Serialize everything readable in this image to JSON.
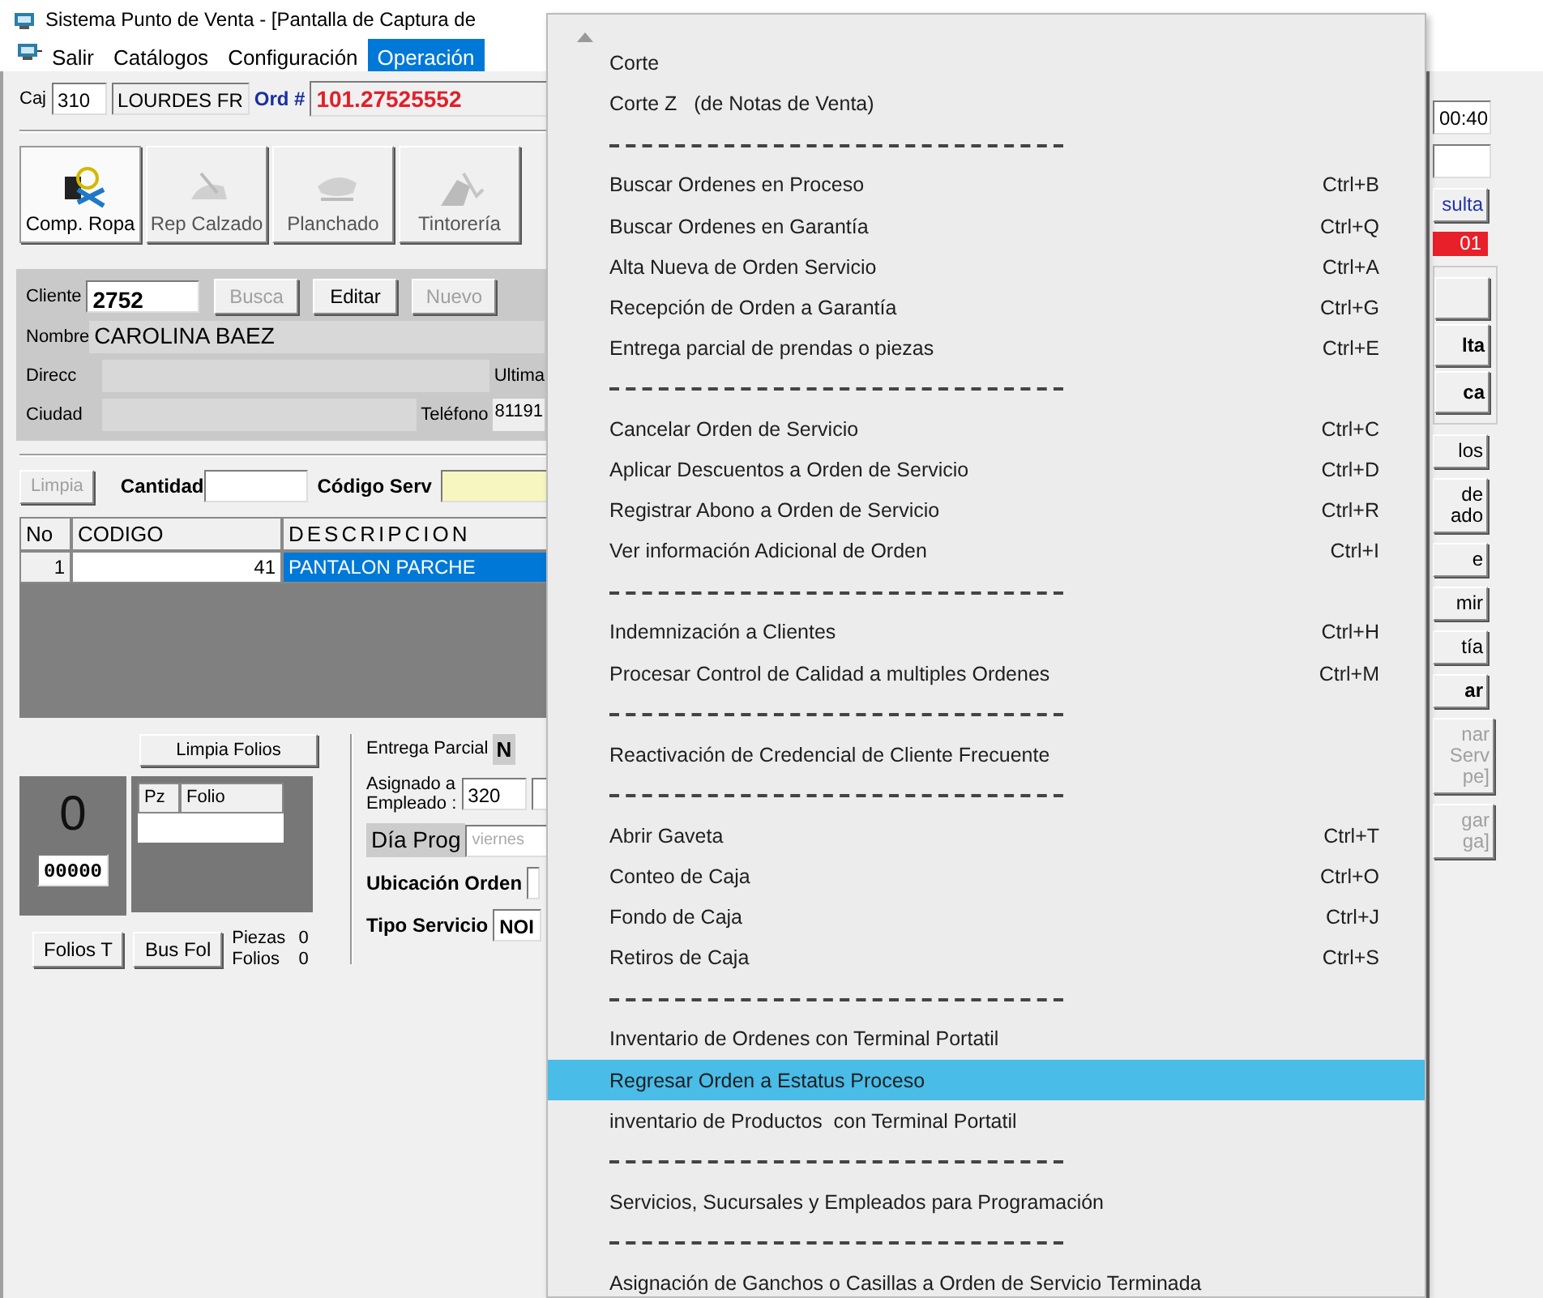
{
  "window": {
    "title": "Sistema Punto de Venta - [Pantalla de Captura de"
  },
  "menubar": [
    {
      "label": "Salir",
      "selected": false
    },
    {
      "label": "Catálogos",
      "selected": false
    },
    {
      "label": "Configuración",
      "selected": false
    },
    {
      "label": "Operación",
      "selected": true
    }
  ],
  "header": {
    "caja_label": "Caj",
    "caja": "310",
    "cashier": "LOURDES FR",
    "order_label": "Ord #",
    "order": "101.27525552"
  },
  "service_buttons": [
    {
      "label": "Comp. Ropa",
      "selected": true
    },
    {
      "label": "Rep Calzado",
      "selected": false
    },
    {
      "label": "Planchado",
      "selected": false
    },
    {
      "label": "Tintorería",
      "selected": false
    }
  ],
  "client": {
    "cliente_label": "Cliente",
    "cliente": "2752",
    "buttons": [
      {
        "label": "Busca",
        "disabled": true
      },
      {
        "label": "Editar",
        "disabled": false
      },
      {
        "label": "Nuevo",
        "disabled": true
      }
    ],
    "nombre_label": "Nombre",
    "nombre": "CAROLINA BAEZ",
    "direcc_label": "Direcc",
    "ultima_label": "Ultima",
    "ciudad_label": "Ciudad",
    "telefono_label": "Teléfono",
    "telefono": "81191"
  },
  "entry": {
    "limpia": {
      "label": "Limpia",
      "disabled": true
    },
    "cantidad_label": "Cantidad",
    "codigo_label": "Código Serv"
  },
  "grid": {
    "columns": [
      "No",
      "CODIGO",
      "DESCRIPCION"
    ],
    "rows": [
      {
        "cells": [
          "1",
          "41",
          "PANTALON PARCHE"
        ],
        "selected": true
      }
    ]
  },
  "folios": {
    "limpia_folios": "Limpia Folios",
    "count": "0",
    "number": "00000",
    "columns": [
      "Pz",
      "Folio"
    ],
    "folios_t": "Folios T",
    "bus_fol": "Bus Fol",
    "piezas_label": "Piezas",
    "piezas": "0",
    "folios_label": "Folios",
    "folios": "0"
  },
  "order_info": {
    "entrega_label": "Entrega Parcial",
    "entrega": "N",
    "asignado_label": "Asignado a",
    "empleado_label": "Empleado :",
    "empleado": "320",
    "dia_label": "Día Prog",
    "dia": "viernes",
    "ubicacion_label": "Ubicación Orden",
    "tipo_label": "Tipo Servicio",
    "tipo": "NOI"
  },
  "side_strip": [
    {
      "kind": "field",
      "lines": [
        "00:40"
      ]
    },
    {
      "kind": "field"
    },
    {
      "kind": "link-button",
      "lines": [
        "sulta"
      ]
    },
    {
      "kind": "badge",
      "lines": [
        "01"
      ]
    },
    {
      "kind": "group"
    },
    {
      "kind": "bold-button",
      "lines": [
        "lta"
      ]
    },
    {
      "kind": "bold-button",
      "lines": [
        "ca"
      ]
    },
    {
      "kind": "button",
      "lines": [
        "los"
      ]
    },
    {
      "kind": "button",
      "lines": [
        "de",
        "ado"
      ]
    },
    {
      "kind": "button",
      "lines": [
        "e"
      ]
    },
    {
      "kind": "button",
      "lines": [
        "mir"
      ]
    },
    {
      "kind": "button",
      "lines": [
        "tía"
      ]
    },
    {
      "kind": "bold-button",
      "lines": [
        "ar"
      ]
    },
    {
      "kind": "disabled-button",
      "lines": [
        "nar",
        "Serv",
        "pe]"
      ]
    },
    {
      "kind": "disabled-button",
      "lines": [
        "gar",
        "ga]"
      ]
    }
  ],
  "menu": {
    "items": [
      {
        "kind": "item",
        "label": "Corte",
        "selected": false
      },
      {
        "kind": "item",
        "label": "Corte Z   (de Notas de Venta)",
        "selected": false
      },
      {
        "kind": "separator"
      },
      {
        "kind": "item",
        "label": "Buscar Ordenes en Proceso",
        "shortcut": "Ctrl+B",
        "selected": false
      },
      {
        "kind": "item",
        "label": "Buscar Ordenes en Garantía",
        "shortcut": "Ctrl+Q",
        "selected": false
      },
      {
        "kind": "item",
        "label": "Alta Nueva de Orden Servicio",
        "shortcut": "Ctrl+A",
        "selected": false
      },
      {
        "kind": "item",
        "label": "Recepción de Orden a Garantía",
        "shortcut": "Ctrl+G",
        "selected": false
      },
      {
        "kind": "item",
        "label": "Entrega parcial de prendas o piezas",
        "shortcut": "Ctrl+E",
        "selected": false
      },
      {
        "kind": "separator"
      },
      {
        "kind": "item",
        "label": "Cancelar Orden de Servicio",
        "shortcut": "Ctrl+C",
        "selected": false
      },
      {
        "kind": "item",
        "label": "Aplicar Descuentos a Orden de Servicio",
        "shortcut": "Ctrl+D",
        "selected": false
      },
      {
        "kind": "item",
        "label": "Registrar Abono a Orden de Servicio",
        "shortcut": "Ctrl+R",
        "selected": false
      },
      {
        "kind": "item",
        "label": "Ver información Adicional de Orden",
        "shortcut": "Ctrl+I",
        "selected": false
      },
      {
        "kind": "separator"
      },
      {
        "kind": "item",
        "label": "Indemnización a Clientes",
        "shortcut": "Ctrl+H",
        "selected": false
      },
      {
        "kind": "item",
        "label": "Procesar Control de Calidad a multiples Ordenes",
        "shortcut": "Ctrl+M",
        "selected": false
      },
      {
        "kind": "separator"
      },
      {
        "kind": "item",
        "label": "Reactivación de Credencial de Cliente Frecuente",
        "selected": false
      },
      {
        "kind": "separator"
      },
      {
        "kind": "item",
        "label": "Abrir Gaveta",
        "shortcut": "Ctrl+T",
        "selected": false
      },
      {
        "kind": "item",
        "label": "Conteo de Caja",
        "shortcut": "Ctrl+O",
        "selected": false
      },
      {
        "kind": "item",
        "label": "Fondo de Caja",
        "shortcut": "Ctrl+J",
        "selected": false
      },
      {
        "kind": "item",
        "label": "Retiros de Caja",
        "shortcut": "Ctrl+S",
        "selected": false
      },
      {
        "kind": "separator"
      },
      {
        "kind": "item",
        "label": "Inventario de Ordenes con Terminal Portatil",
        "selected": false
      },
      {
        "kind": "item",
        "label": "Regresar Orden a Estatus Proceso",
        "selected": true
      },
      {
        "kind": "item",
        "label": "inventario de Productos  con Terminal Portatil",
        "selected": false
      },
      {
        "kind": "separator"
      },
      {
        "kind": "item",
        "label": "Servicios, Sucursales y Empleados para Programación",
        "selected": false
      },
      {
        "kind": "separator"
      },
      {
        "kind": "item",
        "label": "Asignación de Ganchos o Casillas a Orden de Servicio Terminada",
        "selected": false
      }
    ]
  }
}
